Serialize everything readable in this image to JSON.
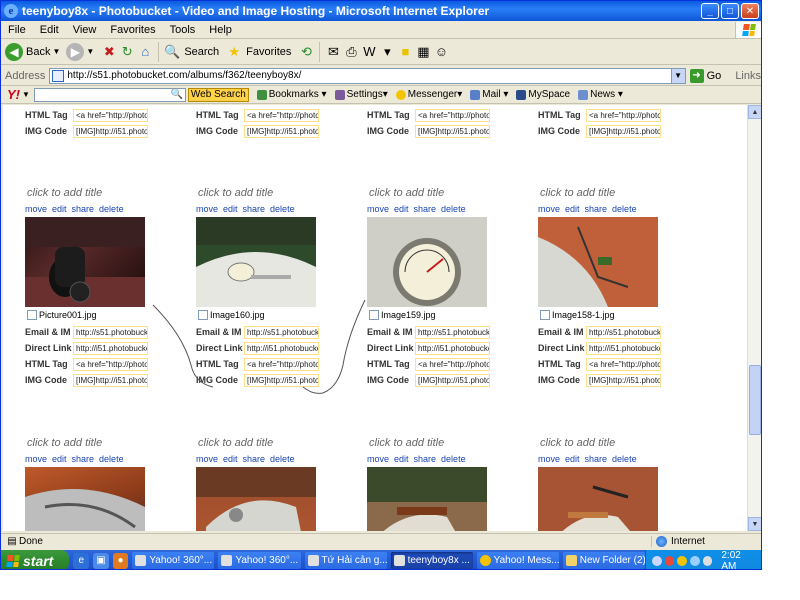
{
  "window": {
    "title": "teenyboy8x - Photobucket - Video and Image Hosting - Microsoft Internet Explorer",
    "controls": {
      "minimize": "_",
      "maximize": "□",
      "close": "✕"
    }
  },
  "menu": [
    "File",
    "Edit",
    "View",
    "Favorites",
    "Tools",
    "Help"
  ],
  "toolbar": {
    "back": "Back",
    "search": "Search",
    "favorites": "Favorites"
  },
  "address": {
    "label": "Address",
    "url": "http://s51.photobucket.com/albums/f362/teenyboy8x/",
    "go": "Go",
    "links": "Links"
  },
  "yahoo": {
    "logo": "Y!",
    "web_search": "Web Search",
    "bookmarks": "Bookmarks",
    "settings": "Settings",
    "messenger": "Messenger",
    "mail": "Mail",
    "myspace": "MySpace",
    "news": "News"
  },
  "labels": {
    "html_tag": "HTML Tag",
    "img_code": "IMG Code",
    "email_im": "Email & IM",
    "direct_link": "Direct Link",
    "click_title": "click to add title",
    "move": "move",
    "edit": "edit",
    "share": "share",
    "delete": "delete"
  },
  "values": {
    "html_tag": "<a href=\"http://photol",
    "img_code": "[IMG]http://i51.photo",
    "email_im": "http://s51.photobucke",
    "direct_link": "http://i51.photobucke"
  },
  "photos": [
    {
      "filename": "Picture001.jpg"
    },
    {
      "filename": "Image160.jpg"
    },
    {
      "filename": "Image159.jpg"
    },
    {
      "filename": "Image158-1.jpg"
    }
  ],
  "status": {
    "text": "Done",
    "zone": "Internet"
  },
  "taskbar": {
    "start": "start",
    "tasks": [
      "Yahoo! 360°...",
      "Yahoo! 360°...",
      "Tứ Hải cản g...",
      "teenyboy8x ...",
      "Yahoo! Mess...",
      "New Folder (2)"
    ],
    "clock": "2:02 AM"
  }
}
